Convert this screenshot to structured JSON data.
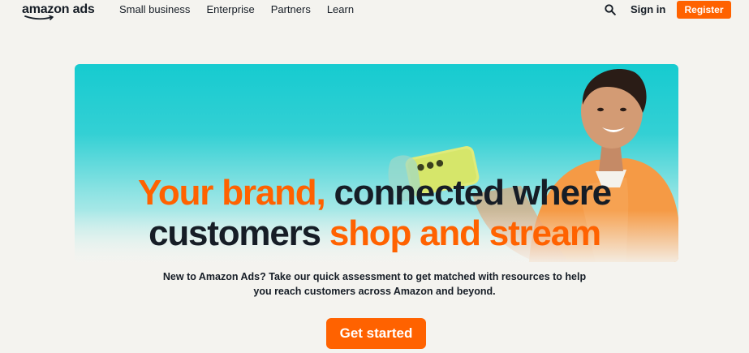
{
  "header": {
    "logo_text": "amazon ads",
    "nav_links": [
      "Small business",
      "Enterprise",
      "Partners",
      "Learn"
    ],
    "search_icon": "search-icon",
    "signin_label": "Sign in",
    "register_label": "Register"
  },
  "hero": {
    "headline_part1": "Your brand,",
    "headline_part2": " connected where",
    "headline_part3": "customers ",
    "headline_part4": "shop and stream",
    "subtext_line1": "New to Amazon Ads? Take our quick assessment to get matched with resources to help",
    "subtext_line2": "you reach customers across Amazon and beyond.",
    "cta_label": "Get started"
  },
  "colors": {
    "accent": "#ff6200",
    "text": "#161d26",
    "background": "#f4f3ef",
    "hero_teal": "#16cbd0"
  }
}
